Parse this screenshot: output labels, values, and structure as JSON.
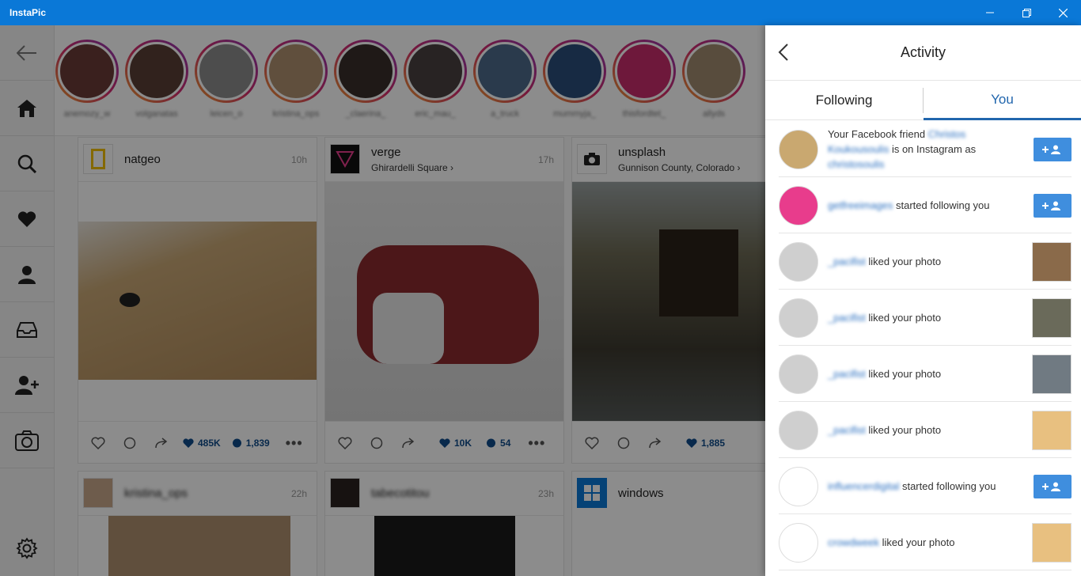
{
  "window": {
    "title": "InstaPic"
  },
  "nav": {
    "items": [
      {
        "name": "back-arrow-icon"
      },
      {
        "name": "home-icon"
      },
      {
        "name": "search-icon"
      },
      {
        "name": "heart-icon"
      },
      {
        "name": "profile-icon"
      },
      {
        "name": "inbox-icon"
      },
      {
        "name": "add-user-icon"
      },
      {
        "name": "camera-icon"
      },
      {
        "name": "settings-icon"
      }
    ]
  },
  "stories": [
    {
      "username": "anemozy_w",
      "color": "#6b3b38"
    },
    {
      "username": "volganatas",
      "color": "#5a3e35"
    },
    {
      "username": "leicen_o",
      "color": "#8c8c8c"
    },
    {
      "username": "kristina_ops",
      "color": "#b09070"
    },
    {
      "username": "_claerina_",
      "color": "#3a2e2a"
    },
    {
      "username": "eric_mau_",
      "color": "#4a4040"
    },
    {
      "username": "a_truck",
      "color": "#4d6a8a"
    },
    {
      "username": "mummyja_",
      "color": "#2a4d7a"
    },
    {
      "username": "thisfordtet_",
      "color": "#c82c6c"
    },
    {
      "username": "allyds",
      "color": "#a08a70"
    }
  ],
  "posts": [
    {
      "username": "natgeo",
      "location": "",
      "time": "10h",
      "likes": "485K",
      "comments": "1,839",
      "photo_color": "#8b6d48"
    },
    {
      "username": "verge",
      "location": "Ghirardelli Square",
      "time": "17h",
      "likes": "10K",
      "comments": "54",
      "photo_color": "#7a7a7a"
    },
    {
      "username": "unsplash",
      "location": "Gunnison County, Colorado",
      "time": "",
      "likes": "1,885",
      "comments": "",
      "photo_color": "#3d3a30"
    }
  ],
  "posts_row2": [
    {
      "username": "kristina_ops",
      "time": "22h"
    },
    {
      "username": "tabecotitou",
      "time": "23h"
    },
    {
      "username": "windows",
      "time": ""
    }
  ],
  "activity": {
    "title": "Activity",
    "tabs": [
      {
        "label": "Following"
      },
      {
        "label": "You"
      }
    ],
    "items": [
      {
        "user_blur": "Christos Koukousoulis",
        "text_pre": "Your Facebook friend ",
        "text_mid": " is on Instagram as ",
        "user2_blur": "christosoulis",
        "action": "follow",
        "avatar_color": "#c9a870"
      },
      {
        "user_blur": "getfreeimages",
        "text_post": " started following you",
        "action": "follow",
        "avatar_color": "#e83c8c"
      },
      {
        "user_blur": "_pacifist",
        "text_post": " liked your photo",
        "action": "thumb",
        "avatar_color": "#cfcfcf",
        "thumb_color": "#8a6a4a"
      },
      {
        "user_blur": "_pacifist",
        "text_post": " liked your photo",
        "action": "thumb",
        "avatar_color": "#cfcfcf",
        "thumb_color": "#6a6a5a"
      },
      {
        "user_blur": "_pacifist",
        "text_post": " liked your photo",
        "action": "thumb",
        "avatar_color": "#cfcfcf",
        "thumb_color": "#707a82"
      },
      {
        "user_blur": "_pacifist",
        "text_post": " liked your photo",
        "action": "thumb",
        "avatar_color": "#cfcfcf",
        "thumb_color": "#e8c080"
      },
      {
        "user_blur": "influencerdigital",
        "text_post": " started following you",
        "action": "follow",
        "avatar_color": "#ffffff"
      },
      {
        "user_blur": "crowdweek",
        "text_post": " liked your photo",
        "action": "thumb",
        "avatar_color": "#ffffff",
        "thumb_color": "#e8c080"
      }
    ]
  }
}
